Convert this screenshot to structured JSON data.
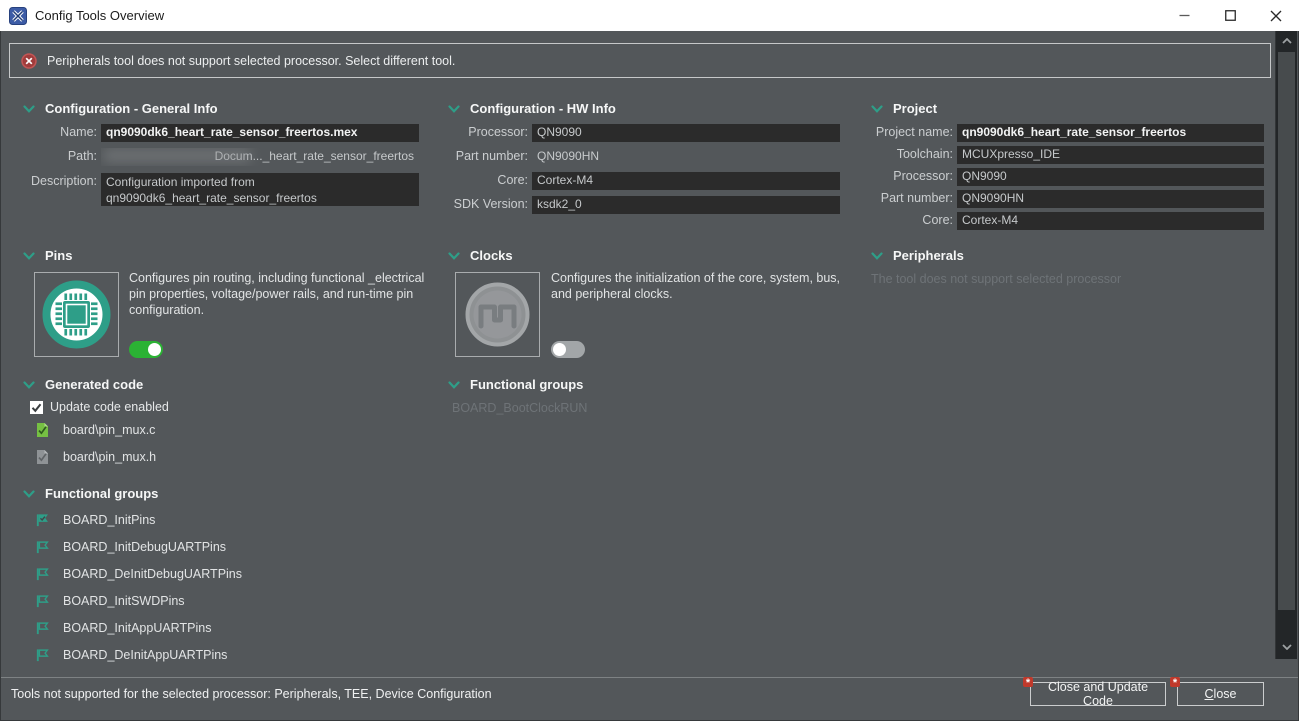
{
  "window": {
    "title": "Config Tools Overview"
  },
  "banner": {
    "text": "Peripherals tool does not support selected processor. Select different tool."
  },
  "sections": {
    "general": {
      "header": "Configuration - General Info",
      "rows": [
        {
          "label": "Name:",
          "value": "qn9090dk6_heart_rate_sensor_freertos.mex"
        },
        {
          "label": "Path:",
          "value": "Docum..._heart_rate_sensor_freertos"
        },
        {
          "label": "Description:",
          "value": "Configuration imported from qn9090dk6_heart_rate_sensor_freertos"
        }
      ]
    },
    "hw": {
      "header": "Configuration - HW Info",
      "rows": [
        {
          "label": "Processor:",
          "value": "QN9090"
        },
        {
          "label": "Part number:",
          "value": "QN9090HN"
        },
        {
          "label": "Core:",
          "value": "Cortex-M4"
        },
        {
          "label": "SDK Version:",
          "value": "ksdk2_0"
        }
      ]
    },
    "project": {
      "header": "Project",
      "rows": [
        {
          "label": "Project name:",
          "value": "qn9090dk6_heart_rate_sensor_freertos"
        },
        {
          "label": "Toolchain:",
          "value": "MCUXpresso_IDE"
        },
        {
          "label": "Processor:",
          "value": "QN9090"
        },
        {
          "label": "Part number:",
          "value": "QN9090HN"
        },
        {
          "label": "Core:",
          "value": "Cortex-M4"
        }
      ]
    },
    "pins": {
      "header": "Pins",
      "description": "Configures pin routing, including functional _electrical pin properties, voltage/power rails, and run-time pin configuration.",
      "toggle_on": true,
      "icon": "pins-chip-icon"
    },
    "clocks": {
      "header": "Clocks",
      "description": "Configures the initialization of the core, system, bus, and peripheral clocks.",
      "toggle_on": false,
      "icon": "clocks-wave-icon"
    },
    "peripherals": {
      "header": "Peripherals",
      "message": "The tool does not support selected processor"
    },
    "generated_code": {
      "header": "Generated code",
      "checkbox_label": "Update code enabled",
      "checked": true,
      "files": [
        {
          "name": "board\\pin_mux.c",
          "icon": "file-check-green-icon"
        },
        {
          "name": "board\\pin_mux.h",
          "icon": "file-check-gray-icon"
        }
      ]
    },
    "functional_groups_pins": {
      "header": "Functional groups",
      "items": [
        {
          "label": "BOARD_InitPins",
          "icon": "flag-filled-check-icon"
        },
        {
          "label": "BOARD_InitDebugUARTPins",
          "icon": "flag-outline-icon"
        },
        {
          "label": "BOARD_DeInitDebugUARTPins",
          "icon": "flag-outline-icon"
        },
        {
          "label": "BOARD_InitSWDPins",
          "icon": "flag-outline-icon"
        },
        {
          "label": "BOARD_InitAppUARTPins",
          "icon": "flag-outline-icon"
        },
        {
          "label": "BOARD_DeInitAppUARTPins",
          "icon": "flag-outline-icon"
        }
      ]
    },
    "functional_groups_clocks": {
      "header": "Functional groups",
      "items": [
        {
          "label": "BOARD_BootClockRUN",
          "disabled": true
        }
      ]
    }
  },
  "footer": {
    "status": "Tools not supported for the selected processor: Peripherals, TEE, Device Configuration",
    "close_update_label": "Close and Update Code",
    "close_mnemonic": "C",
    "close_rest": "lose",
    "badge_glyph": "*"
  },
  "colors": {
    "accent_teal": "#2E9E88",
    "toggle_on_green": "#2BB234",
    "error_red": "#C0392B",
    "field_bg": "#2B2B2B",
    "dialog_bg": "#53575A",
    "titlebar_bg": "#FFFFFF",
    "app_icon_blue": "#3D5CA6"
  }
}
